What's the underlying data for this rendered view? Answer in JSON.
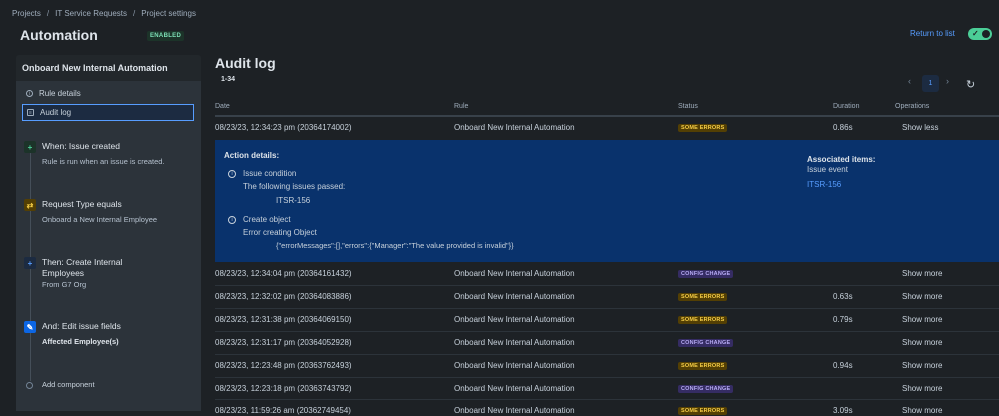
{
  "breadcrumb": {
    "projects": "Projects",
    "sep1": "/",
    "project": "IT Service Requests",
    "sep2": "/",
    "settings": "Project settings"
  },
  "header": {
    "title": "Automation",
    "badge": "ENABLED",
    "return_link": "Return to list",
    "toggle_icon": "check-icon"
  },
  "sidebar": {
    "rule_name": "Onboard New Internal Automation",
    "nav": [
      {
        "label": "Rule details",
        "icon": "info-icon"
      },
      {
        "label": "Audit log",
        "icon": "document-icon"
      }
    ],
    "steps": [
      {
        "title": "When: Issue created",
        "desc": "Rule is run when an issue is created.",
        "icon": "plus-icon",
        "color": "#1f845a"
      },
      {
        "title": "Request Type equals",
        "desc": "Onboard a New Internal Employee",
        "icon": "shuffle-icon",
        "color": "#a54800"
      },
      {
        "title_line1": "Then: Create Internal",
        "title_line2": "Employees",
        "desc": "From G7 Org",
        "icon": "plus-icon",
        "color": "#0c66e4"
      },
      {
        "title": "And: Edit issue fields",
        "desc": "Affected Employee(s)",
        "icon": "pencil-icon",
        "color": "#0c66e4"
      }
    ],
    "add_component": "Add component"
  },
  "audit": {
    "title": "Audit log",
    "range": "1-34",
    "page": "1",
    "columns": {
      "date": "Date",
      "rule": "Rule",
      "status": "Status",
      "duration": "Duration",
      "operations": "Operations"
    },
    "rows": [
      {
        "date": "08/23/23, 12:34:23 pm (20364174002)",
        "rule": "Onboard New Internal Automation",
        "status": "SOME ERRORS",
        "duration": "0.86s",
        "op": "Show less"
      },
      {
        "date": "08/23/23, 12:34:04 pm (20364161432)",
        "rule": "Onboard New Internal Automation",
        "status": "CONFIG CHANGE",
        "duration": "",
        "op": "Show more"
      },
      {
        "date": "08/23/23, 12:32:02 pm (20364083886)",
        "rule": "Onboard New Internal Automation",
        "status": "SOME ERRORS",
        "duration": "0.63s",
        "op": "Show more"
      },
      {
        "date": "08/23/23, 12:31:38 pm (20364069150)",
        "rule": "Onboard New Internal Automation",
        "status": "SOME ERRORS",
        "duration": "0.79s",
        "op": "Show more"
      },
      {
        "date": "08/23/23, 12:31:17 pm (20364052928)",
        "rule": "Onboard New Internal Automation",
        "status": "CONFIG CHANGE",
        "duration": "",
        "op": "Show more"
      },
      {
        "date": "08/23/23, 12:23:48 pm (20363762493)",
        "rule": "Onboard New Internal Automation",
        "status": "SOME ERRORS",
        "duration": "0.94s",
        "op": "Show more"
      },
      {
        "date": "08/23/23, 12:23:18 pm (20363743792)",
        "rule": "Onboard New Internal Automation",
        "status": "CONFIG CHANGE",
        "duration": "",
        "op": "Show more"
      },
      {
        "date": "08/23/23, 11:59:26 am (20362749454)",
        "rule": "Onboard New Internal Automation",
        "status": "SOME ERRORS",
        "duration": "3.09s",
        "op": "Show more"
      }
    ],
    "details": {
      "heading": "Action details:",
      "cond_title": "Issue condition",
      "cond_text": "The following issues passed:",
      "cond_issue": "ITSR-156",
      "create_title": "Create object",
      "create_text": "Error creating Object",
      "create_error": "{\"errorMessages\":[],\"errors\":{\"Manager\":\"The value provided is invalid\"}}",
      "assoc_title": "Associated items:",
      "assoc_sub": "Issue event",
      "assoc_link": "ITSR-156"
    }
  },
  "colors": {
    "accent": "#579dff",
    "error_lozenge": "#f5cd47",
    "config_lozenge": "#b8acf6",
    "details_bg": "#09326c"
  }
}
